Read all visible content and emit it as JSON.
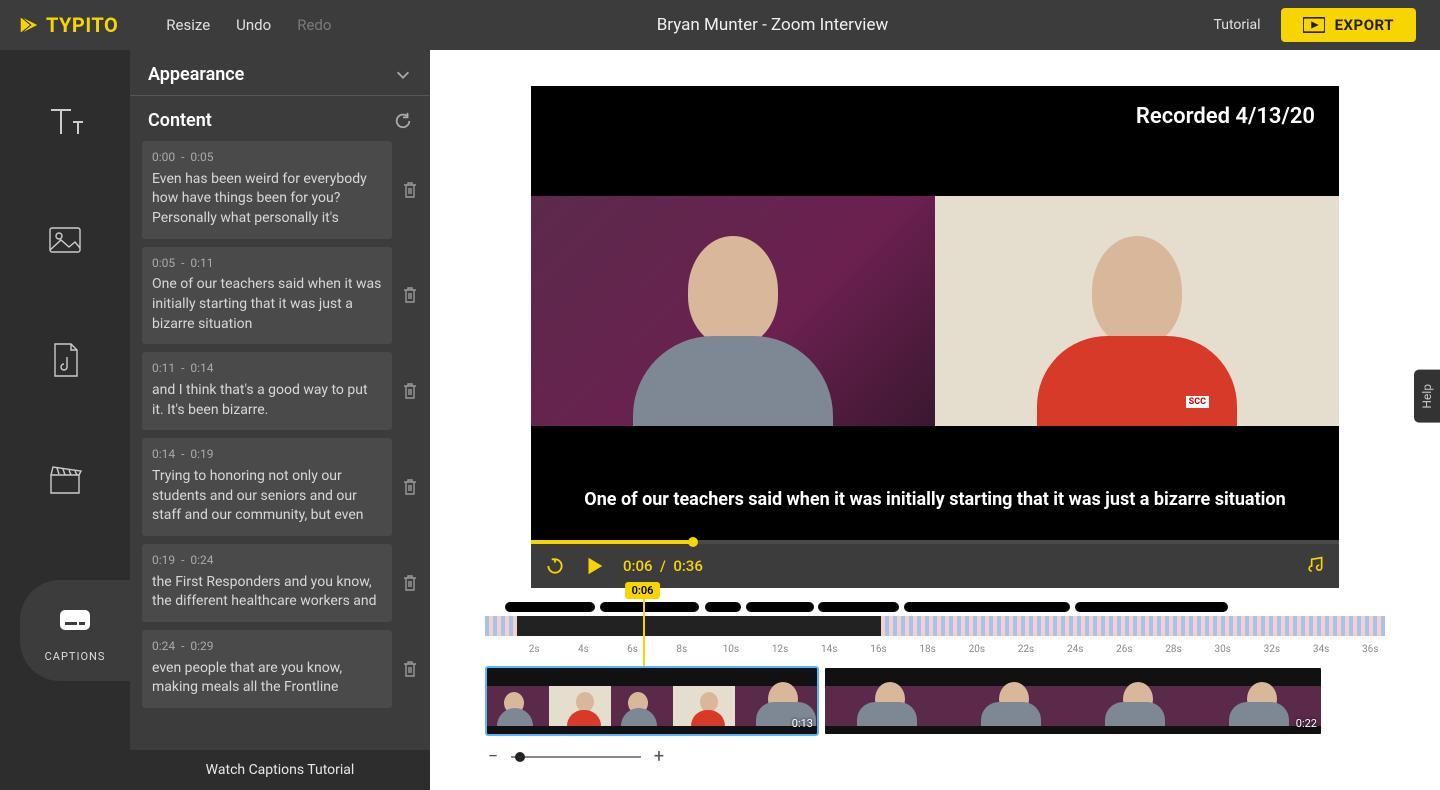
{
  "topbar": {
    "logo_text": "TYPITO",
    "resize": "Resize",
    "undo": "Undo",
    "redo": "Redo",
    "project_title": "Bryan Munter - Zoom Interview",
    "tutorial": "Tutorial",
    "export": "EXPORT"
  },
  "iconbar": {
    "text": "Text",
    "image": "Image",
    "audio": "Audio",
    "video": "Video",
    "captions": "CAPTIONS"
  },
  "panel": {
    "appearance": "Appearance",
    "content": "Content",
    "watch_tutorial": "Watch Captions Tutorial"
  },
  "captions": [
    {
      "start": "0:00",
      "end": "0:05",
      "text": "Even has been weird for everybody how have things been for you? Personally what personally it's"
    },
    {
      "start": "0:05",
      "end": "0:11",
      "text": "One of our teachers said when it was initially starting that it was just a bizarre situation"
    },
    {
      "start": "0:11",
      "end": "0:14",
      "text": "and I think that's a good way to put it. It's been bizarre."
    },
    {
      "start": "0:14",
      "end": "0:19",
      "text": "Trying to honoring not only our students and our seniors and our staff and our community, but even"
    },
    {
      "start": "0:19",
      "end": "0:24",
      "text": "the First Responders and you know, the different healthcare workers and"
    },
    {
      "start": "0:24",
      "end": "0:29",
      "text": "even people that are you know, making meals all the Frontline"
    }
  ],
  "video": {
    "recorded_badge": "Recorded 4/13/20",
    "overlay_caption": "One of our teachers said when it was initially starting that it was just a bizarre situation",
    "right_logo": "SCC"
  },
  "playbar": {
    "current": "0:06",
    "sep": "/",
    "total": "0:36",
    "progress_pct": 20
  },
  "timeline": {
    "playhead_label": "0:06",
    "playhead_pct": 17.5,
    "ruler_ticks": [
      "2s",
      "4s",
      "6s",
      "8s",
      "10s",
      "12s",
      "14s",
      "16s",
      "18s",
      "20s",
      "22s",
      "24s",
      "26s",
      "28s",
      "30s",
      "32s",
      "34s",
      "36s"
    ],
    "black_bars": [
      {
        "left_pct": 2.2,
        "width_pct": 10
      },
      {
        "left_pct": 12.8,
        "width_pct": 11
      },
      {
        "left_pct": 24.4,
        "width_pct": 4
      },
      {
        "left_pct": 29,
        "width_pct": 7.5
      },
      {
        "left_pct": 37,
        "width_pct": 9
      },
      {
        "left_pct": 46.5,
        "width_pct": 18.5
      },
      {
        "left_pct": 65.5,
        "width_pct": 17
      }
    ],
    "audio_dark": {
      "left_pct": 3.5,
      "width_pct": 40.5
    },
    "clips": [
      {
        "thumbs": 3,
        "kind": "dual",
        "end_label": "0:13",
        "selected": true,
        "extra_single": true
      },
      {
        "thumbs": 4,
        "kind": "single",
        "end_label": "0:22",
        "selected": false
      }
    ]
  },
  "help_tab": "Help",
  "colors": {
    "accent": "#f7d500",
    "panel_bg": "#3c3c3c",
    "dark_bg": "#2d2d2d"
  }
}
